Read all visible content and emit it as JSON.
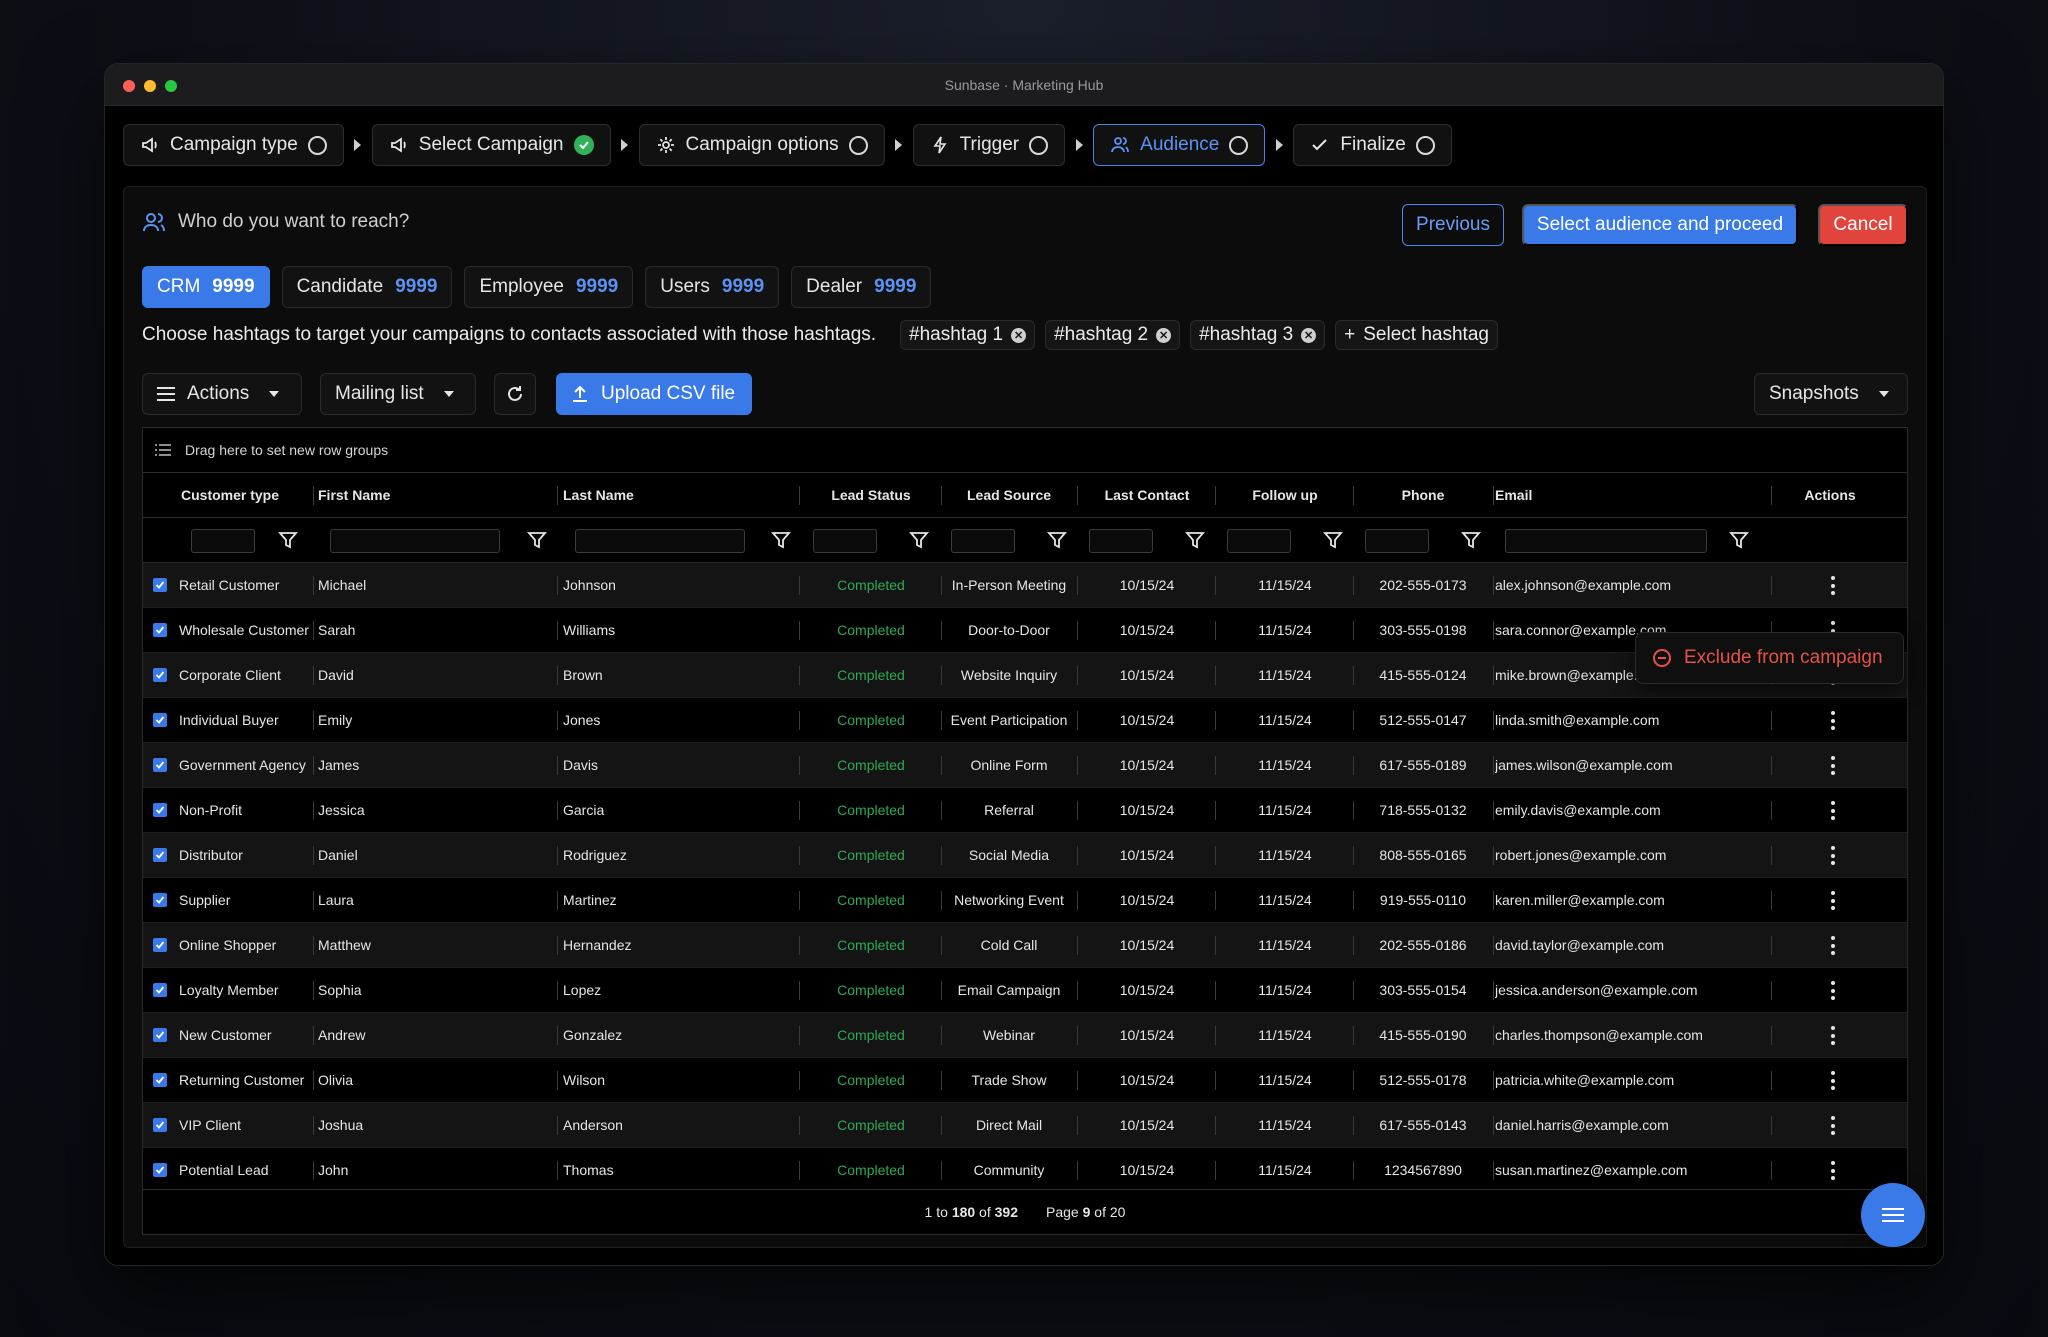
{
  "window": {
    "title": "Sunbase · Marketing Hub"
  },
  "steps": [
    {
      "label": "Campaign type",
      "state": "pending",
      "icon": "megaphone-icon"
    },
    {
      "label": "Select Campaign",
      "state": "done",
      "icon": "megaphone-icon"
    },
    {
      "label": "Campaign options",
      "state": "pending",
      "icon": "gear-icon"
    },
    {
      "label": "Trigger",
      "state": "pending",
      "icon": "lightning-icon"
    },
    {
      "label": "Audience",
      "state": "active",
      "icon": "users-icon"
    },
    {
      "label": "Finalize",
      "state": "pending",
      "icon": "check-icon"
    }
  ],
  "header": {
    "question": "Who do you want to reach?",
    "previous_label": "Previous",
    "proceed_label": "Select audience and proceed",
    "cancel_label": "Cancel"
  },
  "audience_tabs": [
    {
      "label": "CRM",
      "count": "9999",
      "active": true
    },
    {
      "label": "Candidate",
      "count": "9999",
      "active": false
    },
    {
      "label": "Employee",
      "count": "9999",
      "active": false
    },
    {
      "label": "Users",
      "count": "9999",
      "active": false
    },
    {
      "label": "Dealer",
      "count": "9999",
      "active": false
    }
  ],
  "hashtags": {
    "prompt": "Choose hashtags to target your campaigns to contacts associated with those hashtags.",
    "tags": [
      "#hashtag 1",
      "#hashtag 2",
      "#hashtag 3"
    ],
    "add_label": "Select hashtag"
  },
  "toolbar": {
    "actions_label": "Actions",
    "mailing_label": "Mailing list",
    "upload_label": "Upload CSV file",
    "snapshots_label": "Snapshots"
  },
  "grid": {
    "group_hint": "Drag here to set new row groups",
    "columns": [
      "Customer type",
      "First Name",
      "Last Name",
      "Lead Status",
      "Lead Source",
      "Last Contact",
      "Follow up",
      "Phone",
      "Email",
      "Actions"
    ],
    "rows": [
      [
        "Retail Customer",
        "Michael",
        "Johnson",
        "Completed",
        "In-Person Meeting",
        "10/15/24",
        "11/15/24",
        "202-555-0173",
        "alex.johnson@example.com"
      ],
      [
        "Wholesale Customer",
        "Sarah",
        "Williams",
        "Completed",
        "Door-to-Door",
        "10/15/24",
        "11/15/24",
        "303-555-0198",
        "sara.connor@example.com"
      ],
      [
        "Corporate Client",
        "David",
        "Brown",
        "Completed",
        "Website Inquiry",
        "10/15/24",
        "11/15/24",
        "415-555-0124",
        "mike.brown@example.com"
      ],
      [
        "Individual Buyer",
        "Emily",
        "Jones",
        "Completed",
        "Event Participation",
        "10/15/24",
        "11/15/24",
        "512-555-0147",
        "linda.smith@example.com"
      ],
      [
        "Government Agency",
        "James",
        "Davis",
        "Completed",
        "Online Form",
        "10/15/24",
        "11/15/24",
        "617-555-0189",
        "james.wilson@example.com"
      ],
      [
        "Non-Profit",
        "Jessica",
        "Garcia",
        "Completed",
        "Referral",
        "10/15/24",
        "11/15/24",
        "718-555-0132",
        "emily.davis@example.com"
      ],
      [
        "Distributor",
        "Daniel",
        "Rodriguez",
        "Completed",
        "Social Media",
        "10/15/24",
        "11/15/24",
        "808-555-0165",
        "robert.jones@example.com"
      ],
      [
        "Supplier",
        "Laura",
        "Martinez",
        "Completed",
        "Networking Event",
        "10/15/24",
        "11/15/24",
        "919-555-0110",
        "karen.miller@example.com"
      ],
      [
        "Online Shopper",
        "Matthew",
        "Hernandez",
        "Completed",
        "Cold Call",
        "10/15/24",
        "11/15/24",
        "202-555-0186",
        "david.taylor@example.com"
      ],
      [
        "Loyalty Member",
        "Sophia",
        "Lopez",
        "Completed",
        "Email Campaign",
        "10/15/24",
        "11/15/24",
        "303-555-0154",
        "jessica.anderson@example.com"
      ],
      [
        "New Customer",
        "Andrew",
        "Gonzalez",
        "Completed",
        "Webinar",
        "10/15/24",
        "11/15/24",
        "415-555-0190",
        "charles.thompson@example.com"
      ],
      [
        "Returning Customer",
        "Olivia",
        "Wilson",
        "Completed",
        "Trade Show",
        "10/15/24",
        "11/15/24",
        "512-555-0178",
        "patricia.white@example.com"
      ],
      [
        "VIP Client",
        "Joshua",
        "Anderson",
        "Completed",
        "Direct Mail",
        "10/15/24",
        "11/15/24",
        "617-555-0143",
        "daniel.harris@example.com"
      ],
      [
        "Potential Lead",
        "John",
        "Thomas",
        "Completed",
        "Community",
        "10/15/24",
        "11/15/24",
        "1234567890",
        "susan.martinez@example.com"
      ]
    ],
    "pagination": {
      "from": "1",
      "to": "180",
      "total": "392",
      "page": "9",
      "pages": "20"
    }
  },
  "context_menu": {
    "exclude_label": "Exclude from campaign"
  },
  "colors": {
    "accent": "#3a7ae8",
    "danger": "#e1443c",
    "success": "#2ea956"
  }
}
